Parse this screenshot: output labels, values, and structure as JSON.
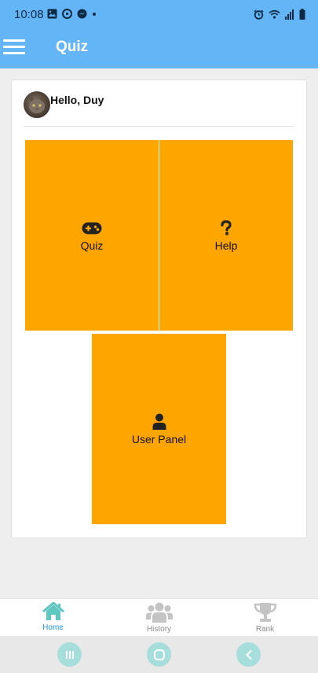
{
  "status_bar": {
    "time": "10:08",
    "left_icons": [
      "image-icon",
      "data-saver-icon",
      "messenger-icon",
      "dot-icon"
    ],
    "right_icons": [
      "alarm-icon",
      "wifi-icon",
      "signal-icon",
      "battery-icon"
    ]
  },
  "app_bar": {
    "title": "Quiz",
    "color": "#64b5f6"
  },
  "greeting": {
    "text": "Hello, Duy"
  },
  "tiles": [
    {
      "label": "Quiz",
      "icon": "gamepad-icon"
    },
    {
      "label": "Help",
      "icon": "question-icon"
    },
    {
      "label": "User Panel",
      "icon": "user-icon"
    }
  ],
  "tile_color": "#ffa500",
  "bottom_nav": {
    "items": [
      {
        "label": "Home",
        "icon": "home-icon",
        "active": true
      },
      {
        "label": "History",
        "icon": "users-icon",
        "active": false
      },
      {
        "label": "Rank",
        "icon": "trophy-icon",
        "active": false
      }
    ],
    "active_color": "#2196f3"
  },
  "system_nav": {
    "buttons": [
      "recent-apps-icon",
      "home-circle-icon",
      "back-icon"
    ]
  }
}
